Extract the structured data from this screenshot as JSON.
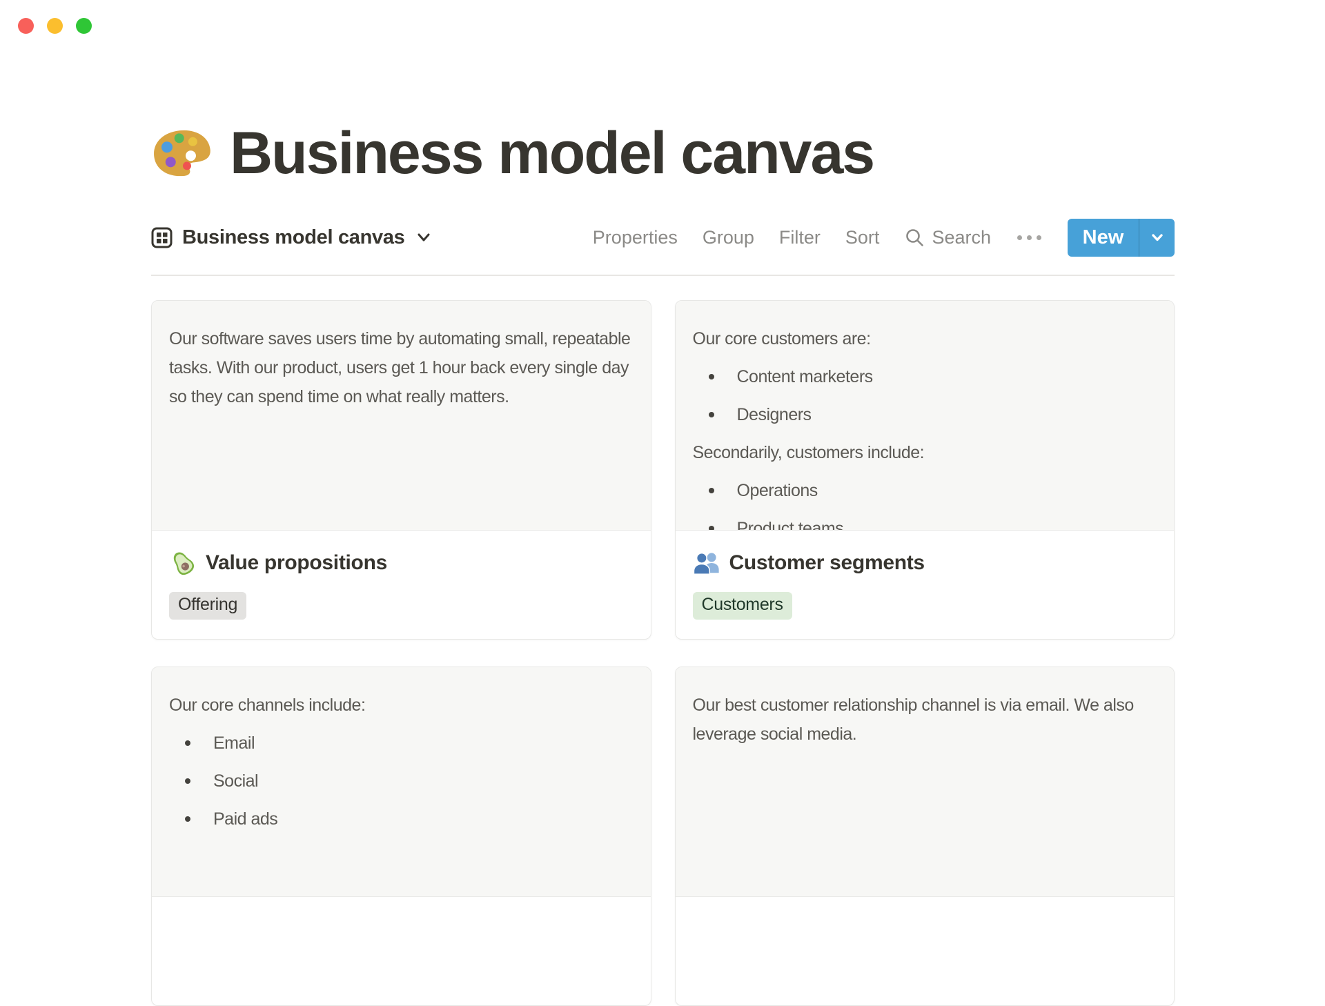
{
  "window": {
    "controls": [
      {
        "name": "close",
        "color": "#f8605a"
      },
      {
        "name": "minimize",
        "color": "#fbbe2e"
      },
      {
        "name": "zoom",
        "color": "#2fc636"
      }
    ]
  },
  "page": {
    "icon": "palette-icon",
    "title": "Business model canvas"
  },
  "view_bar": {
    "view": {
      "icon": "gallery-view-icon",
      "label": "Business model canvas",
      "chevron_icon": "chevron-down-icon"
    },
    "menu": [
      "Properties",
      "Group",
      "Filter",
      "Sort"
    ],
    "search": {
      "icon": "search-icon",
      "label": "Search"
    },
    "more_icon": "ellipsis-icon",
    "new_button": {
      "label": "New",
      "chevron_icon": "chevron-down-icon"
    }
  },
  "cards": [
    {
      "preview_blocks": [
        {
          "type": "p",
          "text": "Our software saves users time by automating small, repeatable tasks. With our product, users get 1 hour back every single day so they can spend time on what really matters."
        }
      ],
      "icon": "avocado",
      "title": "Value propositions",
      "tag": {
        "label": "Offering",
        "color": "gray"
      }
    },
    {
      "preview_blocks": [
        {
          "type": "p",
          "text": "Our core customers are:"
        },
        {
          "type": "li",
          "text": "Content marketers"
        },
        {
          "type": "li",
          "text": "Designers"
        },
        {
          "type": "p",
          "text": "Secondarily, customers include:"
        },
        {
          "type": "li",
          "text": "Operations"
        },
        {
          "type": "li",
          "text": "Product teams"
        }
      ],
      "icon": "busts",
      "title": "Customer segments",
      "tag": {
        "label": "Customers",
        "color": "green"
      }
    },
    {
      "preview_blocks": [
        {
          "type": "p",
          "text": "Our core channels include:"
        },
        {
          "type": "li",
          "text": "Email"
        },
        {
          "type": "li",
          "text": "Social"
        },
        {
          "type": "li",
          "text": "Paid ads"
        }
      ]
    },
    {
      "preview_blocks": [
        {
          "type": "p",
          "text": "Our best customer relationship channel is via email. We also leverage social media."
        }
      ]
    }
  ],
  "colors": {
    "accent_blue": "#47a1d8",
    "preview_bg": "#f7f7f5",
    "tag_gray_bg": "#e3e2e0",
    "tag_green_bg": "#ddecd9",
    "traffic_red": "#f8605a",
    "traffic_yellow": "#fbbe2e",
    "traffic_green": "#2fc636"
  }
}
